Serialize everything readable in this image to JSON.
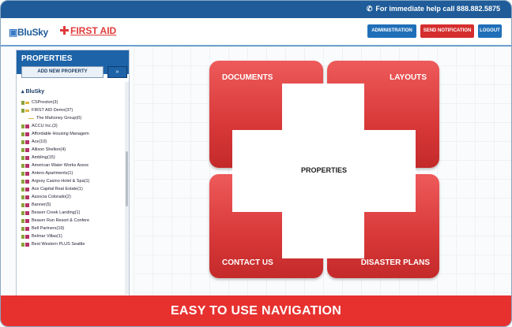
{
  "topbar": {
    "help_text": "For immediate help call 888.882.5875"
  },
  "header": {
    "logo_primary": "BluSky",
    "logo_secondary": "FIRST AID",
    "buttons": {
      "administration": "ADMINISTRATION",
      "send_notification": "SEND NOTIFICATION",
      "logout": "LOGOUT"
    }
  },
  "sidebar": {
    "title": "PROPERTIES",
    "add_button": "ADD NEW PROPERTY",
    "go_button": "»",
    "tree_root": "BluSky",
    "items": [
      "CSPreston(3)",
      "FIRST AID Demo(37)",
      "The Mahoney Group(0)",
      "ACCU Inc.(3)",
      "Affordable Housing Managem",
      "Ace(10)",
      "Allison Shelton(4)",
      "Ambling(15)",
      "American Water Works Assoc",
      "Antero Apartments(1)",
      "Argosy Casino Hotel & Spa(1)",
      "Ace Capital Real Estate(1)",
      "Associa Colorado(2)",
      "Banner(5)",
      "Beaver Creek Landing(1)",
      "Beaver Run Resort & Confere",
      "Bell Partners(19)",
      "Belmar Villas(1)",
      "Best Western PLUS Seattle"
    ]
  },
  "tiles": {
    "documents": "DOCUMENTS",
    "layouts": "LAYOUTS",
    "properties": "PROPERTIES",
    "contact": "CONTACT US",
    "disaster": "DISASTER PLANS"
  },
  "banner": "EASY TO USE NAVIGATION"
}
